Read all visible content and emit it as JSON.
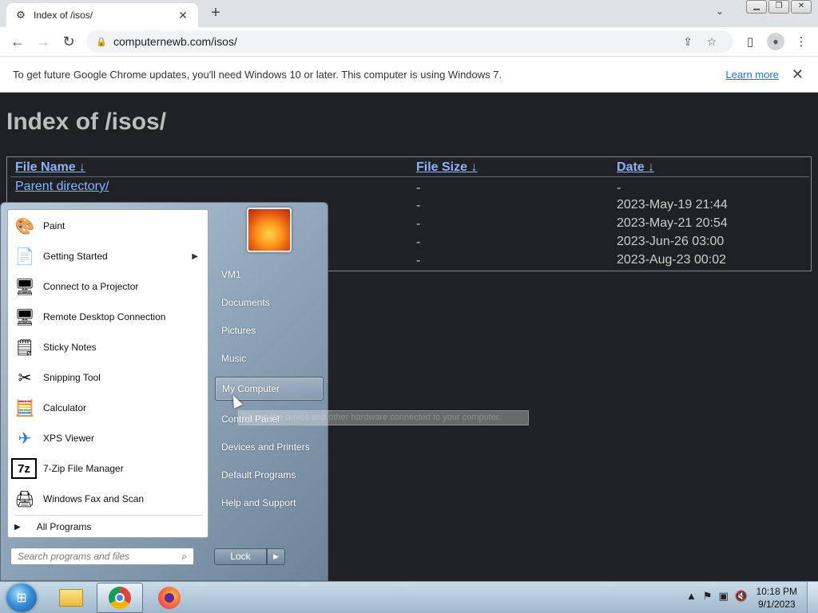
{
  "browser": {
    "tab_title": "Index of /isos/",
    "tab_close": "✕",
    "new_tab": "+",
    "url": "computernewb.com/isos/",
    "infobar_text": "To get future Google Chrome updates, you'll need Windows 10 or later. This computer is using Windows 7.",
    "infobar_link": "Learn more",
    "infobar_close": "✕"
  },
  "page": {
    "heading": "Index of /isos/",
    "columns": [
      "File Name",
      "File Size",
      "Date"
    ],
    "sort_glyph": "↓",
    "rows": [
      {
        "name": "Parent directory/",
        "size": "-",
        "date": "-"
      },
      {
        "name": "",
        "size": "-",
        "date": "2023-May-19 21:44"
      },
      {
        "name": "",
        "size": "-",
        "date": "2023-May-21 20:54"
      },
      {
        "name": "",
        "size": "-",
        "date": "2023-Jun-26 03:00"
      },
      {
        "name": "",
        "size": "-",
        "date": "2023-Aug-23 00:02"
      }
    ]
  },
  "start_menu": {
    "programs": [
      {
        "label": "Paint",
        "icon": "paint-icon",
        "glyph": "🎨"
      },
      {
        "label": "Getting Started",
        "icon": "getting-started-icon",
        "glyph": "📄",
        "submenu": "▶"
      },
      {
        "label": "Connect to a Projector",
        "icon": "projector-icon",
        "glyph": "🖥"
      },
      {
        "label": "Remote Desktop Connection",
        "icon": "remote-desktop-icon",
        "glyph": "🖥"
      },
      {
        "label": "Sticky Notes",
        "icon": "sticky-notes-icon",
        "glyph": "🗒"
      },
      {
        "label": "Snipping Tool",
        "icon": "scissors-icon",
        "glyph": "✂"
      },
      {
        "label": "Calculator",
        "icon": "calculator-icon",
        "glyph": "🧮"
      },
      {
        "label": "XPS Viewer",
        "icon": "xps-viewer-icon",
        "glyph": "✈"
      },
      {
        "label": "7-Zip File Manager",
        "icon": "7zip-icon",
        "glyph": "7z"
      },
      {
        "label": "Windows Fax and Scan",
        "icon": "fax-icon",
        "glyph": "🖨"
      }
    ],
    "all_programs": "All Programs",
    "all_programs_arrow": "▶",
    "search_placeholder": "Search programs and files",
    "right_items": [
      "VM1",
      "Documents",
      "Pictures",
      "Music",
      "My Computer",
      "Control Panel",
      "Devices and Printers",
      "Default Programs",
      "Help and Support"
    ],
    "highlighted": "My Computer",
    "lock_label": "Lock",
    "lock_arrow": "▶",
    "tooltip": "Shows the drives and other hardware connected to your computer."
  },
  "taskbar": {
    "time": "10:18 PM",
    "date": "9/1/2023",
    "tray_expand": "▲"
  }
}
